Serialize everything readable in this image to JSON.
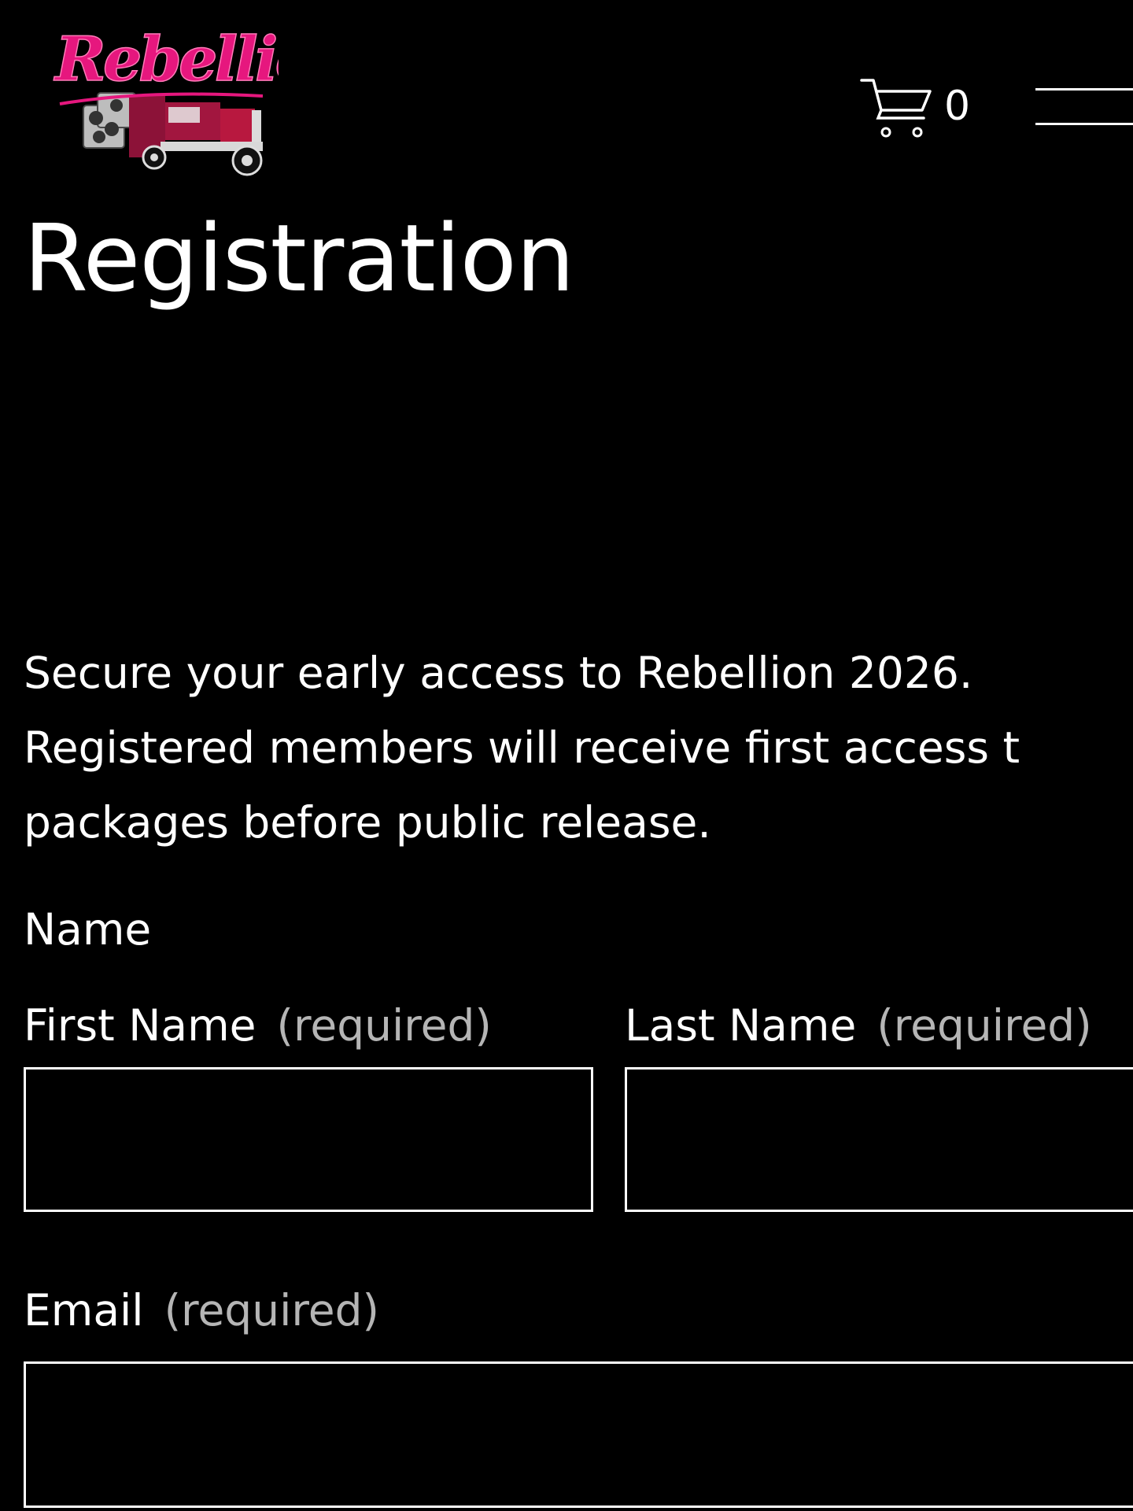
{
  "header": {
    "logo_text": "Rebellion",
    "logo_icon": "truck-logo",
    "cart_icon": "cart-icon",
    "cart_count": "0",
    "menu_icon": "hamburger-menu-icon"
  },
  "page": {
    "title": "Registration",
    "intro_lines": [
      "Secure your early access to Rebellion 2026.",
      "Registered members will receive first access t",
      "packages before public release."
    ]
  },
  "form": {
    "name_group_label": "Name",
    "first_name_label": "First Name",
    "last_name_label": "Last Name",
    "email_label": "Email",
    "required_text": "(required)",
    "first_name_value": "",
    "last_name_value": "",
    "email_value": ""
  },
  "colors": {
    "background": "#000000",
    "text": "#ffffff",
    "muted": "#b5b5b5",
    "brand_pink": "#e6177e",
    "truck_maroon": "#8c1238"
  }
}
